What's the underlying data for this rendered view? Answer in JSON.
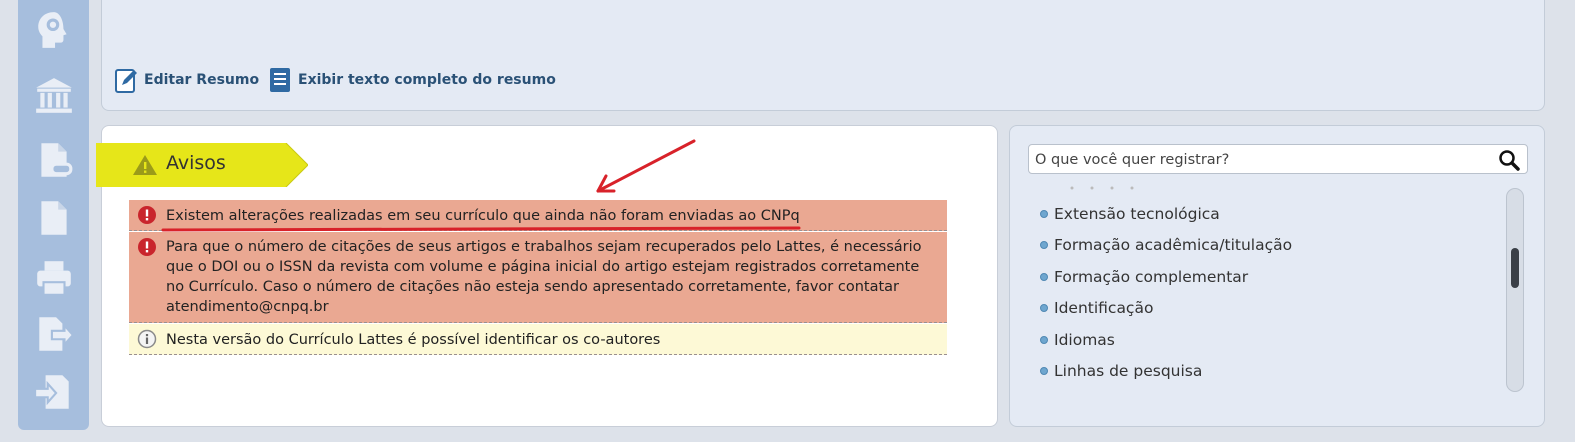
{
  "summary_panel": {
    "actions": [
      {
        "label": "Editar Resumo",
        "icon": "edit-icon"
      },
      {
        "label": "Exibir texto completo do resumo",
        "icon": "document-icon"
      }
    ]
  },
  "left_rail": {
    "icons": [
      "brain-head-icon",
      "institution-icon",
      "document-link-icon",
      "blank-page-icon",
      "printer-icon",
      "export-icon",
      "import-icon"
    ]
  },
  "avisos": {
    "title": "Avisos",
    "items": [
      {
        "type": "error",
        "icon": "error-icon",
        "text": "Existem alterações realizadas em seu currículo que ainda não foram enviadas ao CNPq"
      },
      {
        "type": "error",
        "icon": "error-icon",
        "text_lines": [
          "Para que o número de citações de seus artigos e trabalhos sejam recuperados pelo Lattes, é necessário",
          "que o DOI ou o ISSN da revista com volume e página inicial do artigo estejam registrados corretamente",
          "no Currículo. Caso o número de citações não esteja sendo apresentado corretamente, favor contatar",
          "atendimento@cnpq.br"
        ]
      },
      {
        "type": "info",
        "icon": "info-icon",
        "text": "Nesta versão do Currículo Lattes é possível identificar os co-autores"
      }
    ]
  },
  "register": {
    "search_placeholder": "O que você quer registrar?",
    "items": [
      "Extensão tecnológica",
      "Formação acadêmica/titulação",
      "Formação complementar",
      "Identificação",
      "Idiomas",
      "Linhas de pesquisa"
    ]
  },
  "colors": {
    "rail": "#a6bedd",
    "banner": "#e6e619",
    "error_bg": "#eaa892",
    "info_bg": "#fdf9d6",
    "annotation": "#d8222a"
  }
}
